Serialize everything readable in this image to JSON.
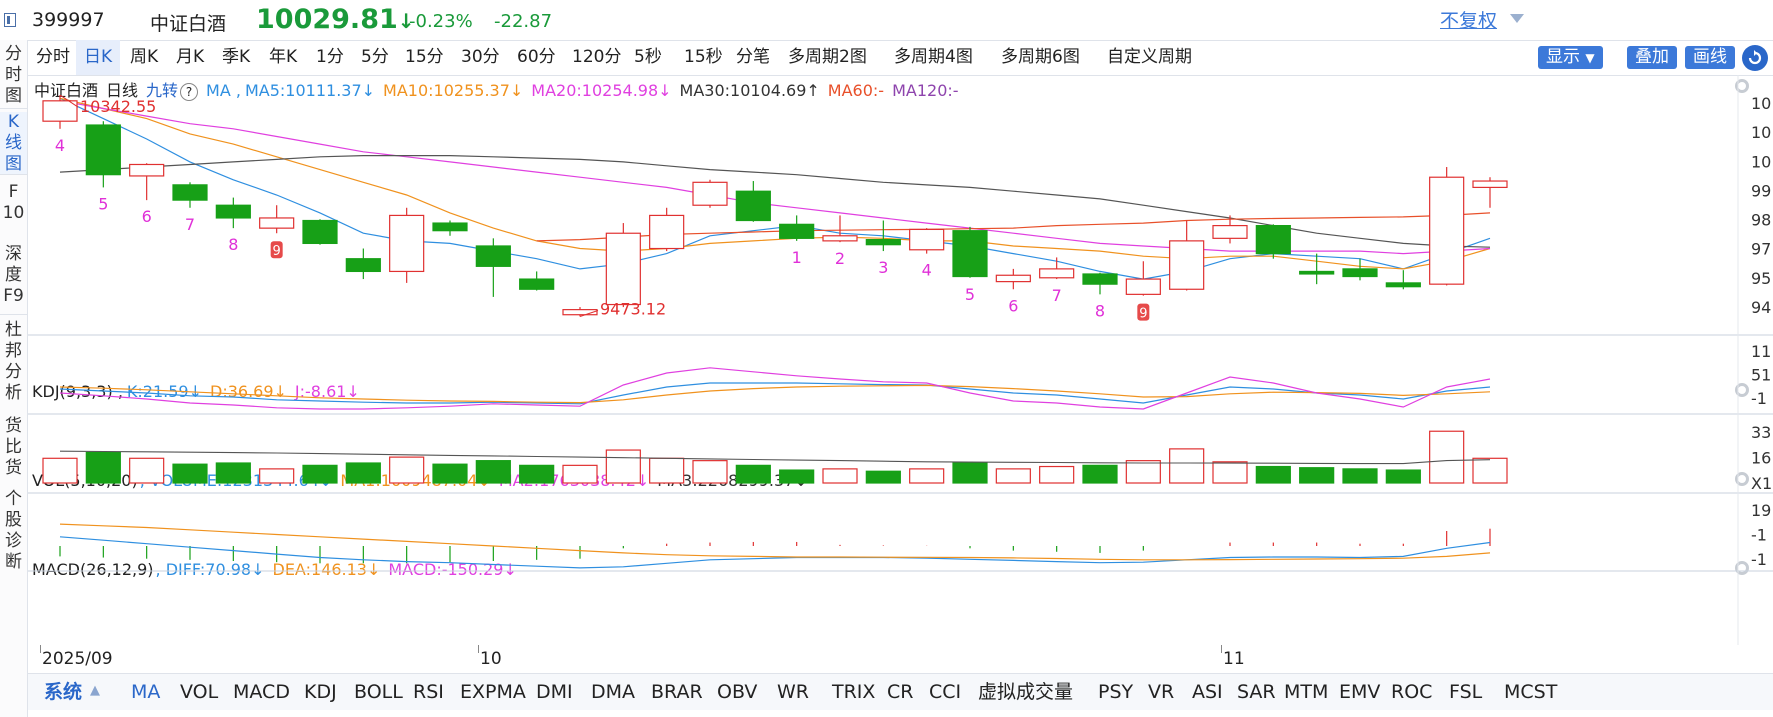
{
  "header": {
    "code": "399997",
    "name": "中证白酒",
    "price": "10029.81",
    "arrow": "↓",
    "change_pct": "-0.23%",
    "change_amt": "-22.87"
  },
  "left_nav": [
    "分时图",
    "K线图",
    "F10",
    "深度F9",
    "杜邦分析",
    "货比货",
    "个股诊断"
  ],
  "period_tabs": [
    "分时",
    "日K",
    "周K",
    "月K",
    "季K",
    "年K",
    "1分",
    "5分",
    "15分",
    "30分",
    "60分",
    "120分",
    "5秒",
    "15秒",
    "分笔",
    "多周期2图",
    "多周期4图",
    "多周期6图",
    "自定义周期"
  ],
  "active_period": "日K",
  "right_controls": {
    "fuquan": "不复权",
    "show": "显示",
    "overlay": "叠加",
    "draw": "画线"
  },
  "main_panel": {
    "title": "中证白酒",
    "period": "日线",
    "jiuzhuan": "九转",
    "help": "?",
    "ma_label": "MA ,",
    "ma": [
      {
        "label": "MA5:10111.37↓",
        "color": "#2f8fe0"
      },
      {
        "label": "MA10:10255.37↓",
        "color": "#f0921e"
      },
      {
        "label": "MA20:10254.98↓",
        "color": "#e040e0"
      },
      {
        "label": "MA30:10104.69↑",
        "color": "#333333"
      },
      {
        "label": "MA60:-",
        "color": "#e8502a"
      },
      {
        "label": "MA120:-",
        "color": "#8e44ad"
      }
    ],
    "high_label": "10342.55",
    "low_label": "9473.12",
    "axis_labels": [
      "10",
      "10",
      "10",
      "99",
      "98",
      "97",
      "95",
      "94"
    ]
  },
  "kdj_panel": {
    "title": "KDJ(9,3,3) ,",
    "values": [
      {
        "label": "K:21.59↓",
        "color": "#2f8fe0"
      },
      {
        "label": "D:36.69↓",
        "color": "#f0921e"
      },
      {
        "label": "J:-8.61↓",
        "color": "#e040e0"
      }
    ],
    "axis_labels": [
      "11",
      "51",
      "-1"
    ]
  },
  "vol_panel": {
    "title": "VOL(5,10,20)",
    "values": [
      {
        "label": ", VOLUME:1231344.64↓",
        "color": "#2f8fe0"
      },
      {
        "label": "MA1:1609487.04↓",
        "color": "#f0921e"
      },
      {
        "label": "MA2:1763038.42↓",
        "color": "#e040e0"
      },
      {
        "label": "MA3:2268299.37↓",
        "color": "#333333"
      }
    ],
    "axis_labels": [
      "33",
      "16",
      "X1"
    ]
  },
  "macd_panel": {
    "title": "MACD(26,12,9)",
    "values": [
      {
        "label": ", DIFF:70.98↓",
        "color": "#2f8fe0"
      },
      {
        "label": "DEA:146.13↓",
        "color": "#f0921e"
      },
      {
        "label": "MACD:-150.29↓",
        "color": "#e040e0"
      }
    ],
    "axis_labels": [
      "19",
      "-1",
      "-1"
    ]
  },
  "date_labels": [
    "2025/09",
    "10",
    "11"
  ],
  "bottom_tabs": [
    "系统",
    "MA",
    "VOL",
    "MACD",
    "KDJ",
    "BOLL",
    "RSI",
    "EXPMA",
    "DMI",
    "DMA",
    "BRAR",
    "OBV",
    "WR",
    "TRIX",
    "CR",
    "CCI",
    "虚拟成交量",
    "PSY",
    "VR",
    "ASI",
    "SAR",
    "MTM",
    "EMV",
    "ROC",
    "FSL",
    "MCST"
  ],
  "chart_data": {
    "type": "candlestick",
    "candles": [
      {
        "o": 10240,
        "c": 10320,
        "h": 10342.55,
        "l": 10210,
        "nine": "4"
      },
      {
        "o": 10225,
        "c": 10030,
        "h": 10240,
        "l": 9980,
        "nine": "5"
      },
      {
        "o": 10025,
        "c": 10070,
        "h": 10075,
        "l": 9930,
        "nine": "6"
      },
      {
        "o": 9990,
        "c": 9930,
        "h": 10000,
        "l": 9900,
        "nine": "7"
      },
      {
        "o": 9910,
        "c": 9860,
        "h": 9940,
        "l": 9820,
        "nine": "8"
      },
      {
        "o": 9820,
        "c": 9860,
        "h": 9910,
        "l": 9800,
        "nine": "9",
        "nine_box": true
      },
      {
        "o": 9850,
        "c": 9760,
        "h": 9855,
        "l": 9755
      },
      {
        "o": 9700,
        "c": 9650,
        "h": 9740,
        "l": 9620
      },
      {
        "o": 9650,
        "c": 9870,
        "h": 9900,
        "l": 9605
      },
      {
        "o": 9840,
        "c": 9810,
        "h": 9850,
        "l": 9790
      },
      {
        "o": 9750,
        "c": 9670,
        "h": 9780,
        "l": 9550
      },
      {
        "o": 9620,
        "c": 9580,
        "h": 9650,
        "l": 9575
      },
      {
        "o": 9480,
        "c": 9500,
        "h": 9510,
        "l": 9473.12
      },
      {
        "o": 9520,
        "c": 9800,
        "h": 9840,
        "l": 9510
      },
      {
        "o": 9740,
        "c": 9870,
        "h": 9900,
        "l": 9730
      },
      {
        "o": 9910,
        "c": 10000,
        "h": 10010,
        "l": 9900
      },
      {
        "o": 9965,
        "c": 9850,
        "h": 10005,
        "l": 9845
      },
      {
        "o": 9835,
        "c": 9780,
        "h": 9870,
        "l": 9770,
        "nine": "1"
      },
      {
        "o": 9770,
        "c": 9790,
        "h": 9870,
        "l": 9765,
        "nine": "2"
      },
      {
        "o": 9775,
        "c": 9755,
        "h": 9850,
        "l": 9730,
        "nine": "3"
      },
      {
        "o": 9735,
        "c": 9815,
        "h": 9820,
        "l": 9720,
        "nine": "4"
      },
      {
        "o": 9810,
        "c": 9630,
        "h": 9825,
        "l": 9625,
        "nine": "5"
      },
      {
        "o": 9610,
        "c": 9635,
        "h": 9660,
        "l": 9580,
        "nine": "6"
      },
      {
        "o": 9625,
        "c": 9660,
        "h": 9705,
        "l": 9620,
        "nine": "7"
      },
      {
        "o": 9640,
        "c": 9600,
        "h": 9645,
        "l": 9560,
        "nine": "8"
      },
      {
        "o": 9560,
        "c": 9620,
        "h": 9690,
        "l": 9555,
        "nine": "9",
        "nine_box": true
      },
      {
        "o": 9580,
        "c": 9770,
        "h": 9850,
        "l": 9575
      },
      {
        "o": 9780,
        "c": 9830,
        "h": 9870,
        "l": 9760
      },
      {
        "o": 9830,
        "c": 9720,
        "h": 9835,
        "l": 9700
      },
      {
        "o": 9650,
        "c": 9640,
        "h": 9720,
        "l": 9600
      },
      {
        "o": 9660,
        "c": 9630,
        "h": 9700,
        "l": 9615
      },
      {
        "o": 9605,
        "c": 9590,
        "h": 9655,
        "l": 9580
      },
      {
        "o": 9600,
        "c": 10020,
        "h": 10060,
        "l": 9595
      },
      {
        "o": 9980,
        "c": 10005,
        "h": 10020,
        "l": 9900
      }
    ],
    "ma_series": [
      {
        "name": "MA5",
        "color": "#2f8fe0",
        "values": [
          10330,
          10250,
          10170,
          10080,
          10010,
          9950,
          9880,
          9800,
          9770,
          9760,
          9730,
          9700,
          9660,
          9680,
          9720,
          9790,
          9810,
          9830,
          9800,
          9790,
          9770,
          9750,
          9720,
          9690,
          9650,
          9620,
          9650,
          9700,
          9720,
          9710,
          9700,
          9660,
          9720,
          9780
        ]
      },
      {
        "name": "MA10",
        "color": "#f0921e",
        "values": [
          10330,
          10290,
          10250,
          10190,
          10150,
          10100,
          10050,
          10000,
          9950,
          9880,
          9820,
          9770,
          9740,
          9730,
          9740,
          9760,
          9770,
          9780,
          9785,
          9780,
          9770,
          9770,
          9750,
          9740,
          9730,
          9710,
          9700,
          9710,
          9710,
          9690,
          9670,
          9660,
          9690,
          9740
        ]
      },
      {
        "name": "MA20",
        "color": "#e040e0",
        "values": [
          10320,
          10290,
          10260,
          10230,
          10210,
          10180,
          10150,
          10120,
          10100,
          10080,
          10060,
          10040,
          10020,
          10000,
          9980,
          9950,
          9920,
          9900,
          9880,
          9860,
          9840,
          9820,
          9800,
          9780,
          9760,
          9750,
          9740,
          9730,
          9730,
          9730,
          9730,
          9720,
          9730,
          9740
        ]
      },
      {
        "name": "MA30",
        "color": "#555555",
        "values": [
          10040,
          10050,
          10060,
          10070,
          10080,
          10090,
          10100,
          10105,
          10105,
          10105,
          10100,
          10095,
          10090,
          10080,
          10065,
          10050,
          10040,
          10030,
          10015,
          10000,
          9990,
          9980,
          9965,
          9950,
          9935,
          9910,
          9885,
          9860,
          9830,
          9800,
          9780,
          9760,
          9750,
          9745
        ]
      },
      {
        "name": "MA60",
        "color": "#e8502a",
        "values": [
          null,
          null,
          null,
          null,
          null,
          null,
          null,
          null,
          null,
          null,
          null,
          9770,
          9775,
          9785,
          9795,
          9800,
          9805,
          9810,
          9812,
          9814,
          9815,
          9818,
          9820,
          9830,
          9835,
          9840,
          9850,
          9855,
          9858,
          9860,
          9862,
          9864,
          9870,
          9880
        ]
      }
    ],
    "price_range": [
      9420,
      10390
    ],
    "kdj": {
      "range": [
        -20,
        115
      ],
      "K": [
        55,
        50,
        45,
        38,
        35,
        28,
        25,
        22,
        20,
        20,
        22,
        20,
        18,
        40,
        60,
        70,
        70,
        70,
        68,
        66,
        65,
        55,
        45,
        40,
        30,
        20,
        40,
        60,
        55,
        45,
        40,
        30,
        50,
        60
      ],
      "D": [
        60,
        57,
        53,
        48,
        43,
        38,
        33,
        30,
        27,
        25,
        24,
        22,
        21,
        28,
        40,
        50,
        56,
        60,
        62,
        63,
        64,
        61,
        56,
        50,
        43,
        35,
        36,
        43,
        47,
        46,
        44,
        39,
        43,
        48
      ],
      "J": [
        45,
        38,
        30,
        20,
        15,
        8,
        5,
        5,
        8,
        12,
        18,
        15,
        12,
        65,
        95,
        108,
        98,
        88,
        80,
        73,
        70,
        45,
        25,
        20,
        10,
        5,
        45,
        85,
        70,
        45,
        30,
        10,
        60,
        80
      ]
    },
    "vol": {
      "range": [
        0,
        3400000
      ],
      "values": [
        2100000,
        2600000,
        2100000,
        1600000,
        1700000,
        1200000,
        1500000,
        1700000,
        2200000,
        1600000,
        1900000,
        1500000,
        1500000,
        2800000,
        2100000,
        1900000,
        1500000,
        1100000,
        1200000,
        1000000,
        1200000,
        1700000,
        1200000,
        1400000,
        1500000,
        1900000,
        2900000,
        1800000,
        1400000,
        1300000,
        1200000,
        1100000,
        4400000,
        2100000
      ],
      "MA3": [
        2700000,
        2680000,
        2650000,
        2620000,
        2580000,
        2550000,
        2500000,
        2450000,
        2400000,
        2350000,
        2300000,
        2250000,
        2200000,
        2150000,
        2100000,
        2050000,
        2000000,
        1950000,
        1900000,
        1850000,
        1800000,
        1780000,
        1760000,
        1740000,
        1720000,
        1700000,
        1700000,
        1690000,
        1680000,
        1670000,
        1650000,
        1650000,
        1900000,
        1980000
      ]
    },
    "macd": {
      "range": [
        -300,
        220
      ],
      "DIFF": [
        80,
        50,
        20,
        -10,
        -40,
        -70,
        -100,
        -120,
        -135,
        -145,
        -160,
        -175,
        -190,
        -180,
        -150,
        -120,
        -110,
        -100,
        -100,
        -100,
        -105,
        -115,
        -125,
        -135,
        -145,
        -140,
        -120,
        -100,
        -95,
        -95,
        -100,
        -90,
        -20,
        30
      ],
      "DEA": [
        190,
        175,
        160,
        140,
        120,
        100,
        80,
        60,
        40,
        20,
        0,
        -20,
        -40,
        -60,
        -75,
        -85,
        -90,
        -95,
        -95,
        -97,
        -98,
        -100,
        -103,
        -108,
        -115,
        -120,
        -120,
        -118,
        -115,
        -113,
        -110,
        -106,
        -90,
        -60
      ],
      "MACD": [
        -90,
        -100,
        -110,
        -120,
        -130,
        -140,
        -150,
        -150,
        -150,
        -140,
        -130,
        -120,
        -110,
        -20,
        20,
        30,
        35,
        35,
        10,
        5,
        2,
        -20,
        -40,
        -50,
        -60,
        -40,
        0,
        30,
        30,
        30,
        20,
        20,
        130,
        150
      ]
    }
  }
}
